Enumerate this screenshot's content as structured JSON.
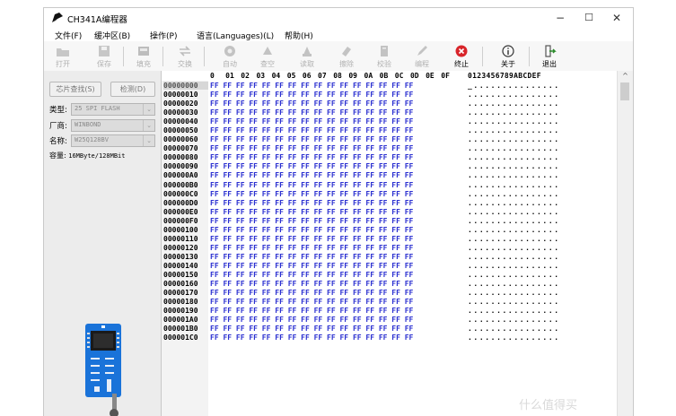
{
  "window": {
    "title": "CH341A编程器",
    "controls": {
      "minimize": "−",
      "maximize": "☐",
      "close": "✕"
    }
  },
  "menu": [
    {
      "label": "文件(F)"
    },
    {
      "label": "缓冲区(B)"
    },
    {
      "label": "操作(P)"
    },
    {
      "label": "语言(Languages)(L)"
    },
    {
      "label": "帮助(H)"
    }
  ],
  "toolbar": {
    "open": "打开",
    "save": "保存",
    "fill": "填充",
    "swap": "交换",
    "auto": "自动",
    "blank": "查空",
    "read": "读取",
    "erase": "擦除",
    "verify": "校验",
    "write": "编程",
    "stop": "终止",
    "about": "关于",
    "exit": "退出"
  },
  "left_panel": {
    "detect_button": "芯片查找(S)",
    "check_button": "检测(D)",
    "type_label": "类型:",
    "type_value": "25 SPI FLASH",
    "vendor_label": "厂商:",
    "vendor_value": "WINBOND",
    "name_label": "名称:",
    "name_value": "W25Q128BV",
    "capacity_label": "容量:",
    "capacity_value": "16MByte/128MBit"
  },
  "hex": {
    "columns": [
      "0",
      "01",
      "02",
      "03",
      "04",
      "05",
      "06",
      "07",
      "08",
      "09",
      "0A",
      "0B",
      "0C",
      "0D",
      "0E",
      "0F"
    ],
    "ascii_header": "0123456789ABCDEF",
    "fill_byte": "FF",
    "ascii_row": "................",
    "first_ascii_cursor": "_",
    "rows": [
      "00000000",
      "00000010",
      "00000020",
      "00000030",
      "00000040",
      "00000050",
      "00000060",
      "00000070",
      "00000080",
      "00000090",
      "000000A0",
      "000000B0",
      "000000C0",
      "000000D0",
      "000000E0",
      "000000F0",
      "00000100",
      "00000110",
      "00000120",
      "00000130",
      "00000140",
      "00000150",
      "00000160",
      "00000170",
      "00000180",
      "00000190",
      "000001A0",
      "000001B0",
      "000001C0"
    ]
  },
  "watermark": "什么值得买"
}
